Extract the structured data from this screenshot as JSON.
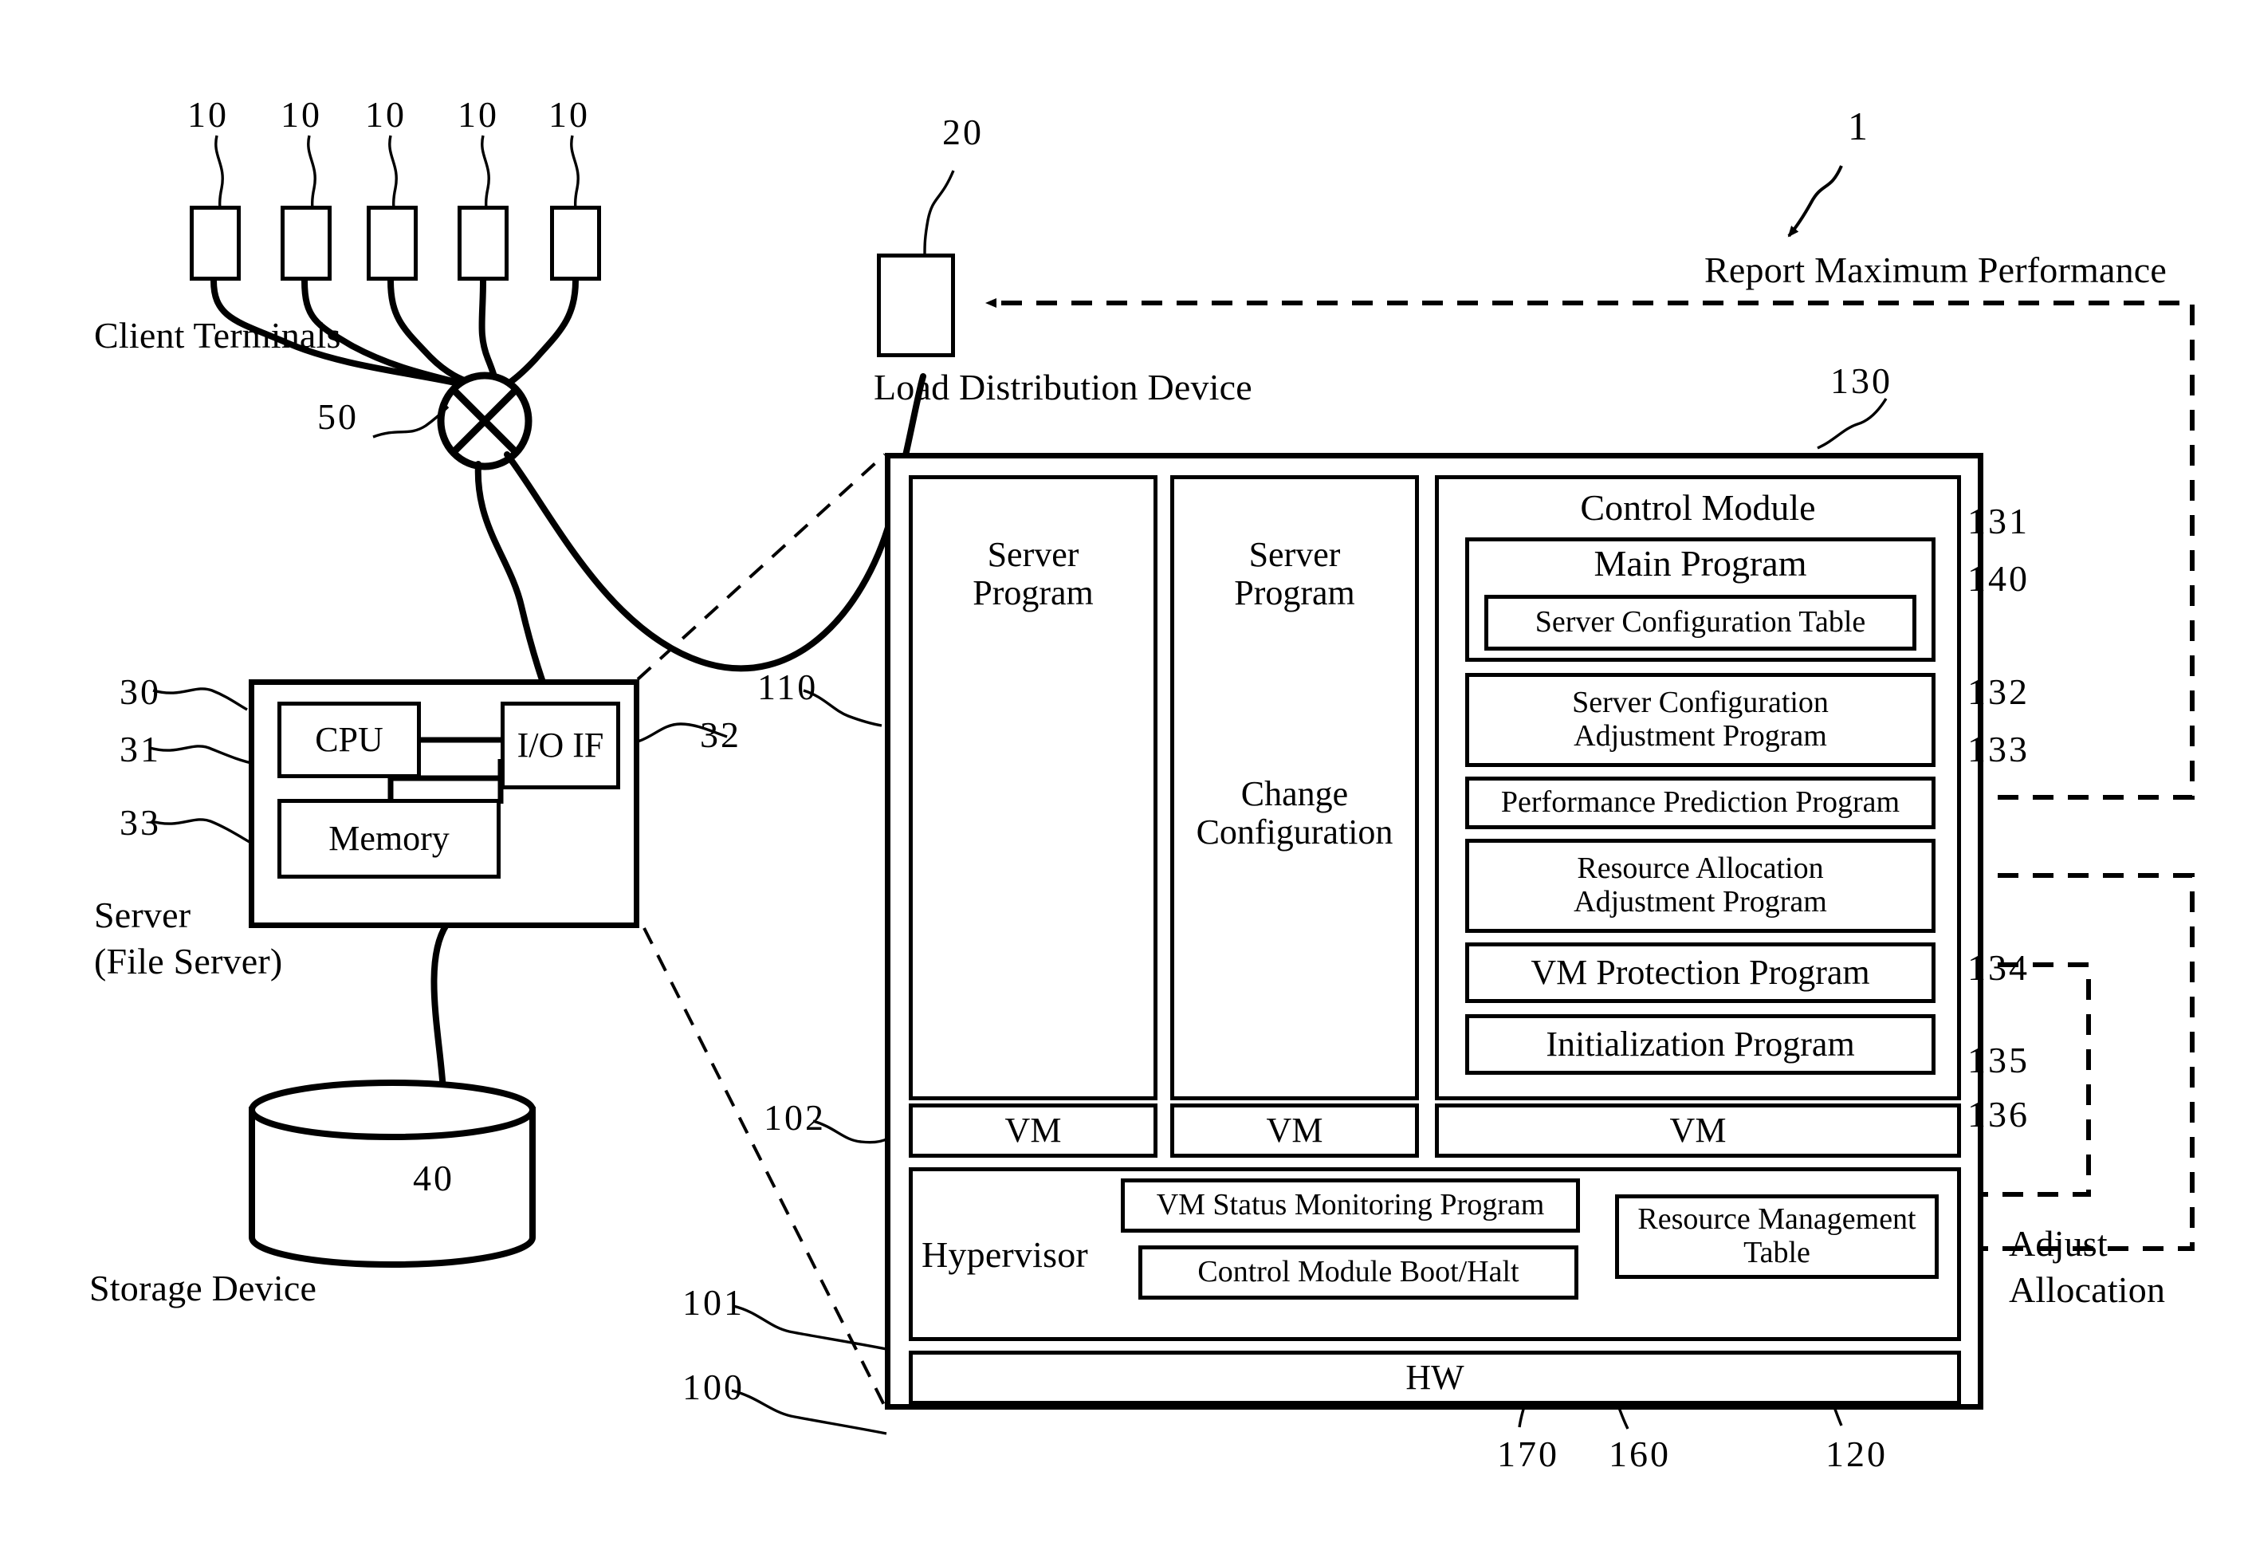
{
  "figure": {
    "system_ref": "1",
    "report_label": "Report Maximum Performance",
    "adjust_label_line1": "Adjust",
    "adjust_label_line2": "Allocation",
    "change_config_line1": "Change",
    "change_config_line2": "Configuration"
  },
  "clients": {
    "caption": "Client Terminals",
    "refs": [
      "10",
      "10",
      "10",
      "10",
      "10"
    ],
    "switch_ref": "50"
  },
  "load_distribution": {
    "ref": "20",
    "caption": "Load Distribution Device"
  },
  "server": {
    "caption_line1": "Server",
    "caption_line2": "(File Server)",
    "ref_outer": "30",
    "ref_cpu": "31",
    "ref_io": "32",
    "ref_memory": "33",
    "cpu_label": "CPU",
    "memory_label": "Memory",
    "io_label": "I/O IF"
  },
  "storage": {
    "ref": "40",
    "caption": "Storage Device"
  },
  "stack": {
    "ref_server_program": "110",
    "ref_vm_row": "102",
    "ref_hypervisor": "101",
    "ref_hw": "100",
    "ref_control_module": "130",
    "ref_main_program": "131",
    "ref_server_config_table": "140",
    "ref_server_config_adj": "132",
    "ref_perf_prediction": "133",
    "ref_resource_alloc_adj": "134",
    "ref_vm_protection": "135",
    "ref_initialization": "136",
    "ref_vm_status_monitor": "170",
    "ref_control_module_boot": "160",
    "ref_resource_mgmt_table": "120",
    "server_program_1_line1": "Server",
    "server_program_1_line2": "Program",
    "server_program_2_line1": "Server",
    "server_program_2_line2": "Program",
    "control_module_title": "Control Module",
    "main_program": "Main Program",
    "server_configuration_table": "Server Configuration Table",
    "server_config_adjust_line1": "Server Configuration",
    "server_config_adjust_line2": "Adjustment Program",
    "performance_prediction_program": "Performance Prediction Program",
    "resource_alloc_adjust_line1": "Resource Allocation",
    "resource_alloc_adjust_line2": "Adjustment Program",
    "vm_protection_program": "VM Protection Program",
    "initialization_program": "Initialization Program",
    "vm_1": "VM",
    "vm_2": "VM",
    "vm_3": "VM",
    "hypervisor": "Hypervisor",
    "vm_status_monitoring_program": "VM Status Monitoring Program",
    "control_module_boot_halt": "Control Module Boot/Halt",
    "resource_management_table_line1": "Resource Management",
    "resource_management_table_line2": "Table",
    "hw": "HW"
  },
  "colors": {
    "ink": "#000000",
    "paper": "#ffffff"
  }
}
